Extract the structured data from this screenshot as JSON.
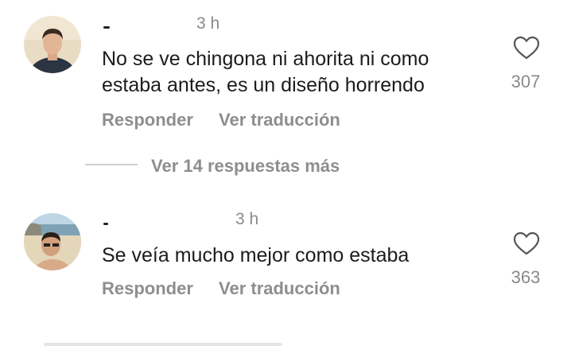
{
  "comments": [
    {
      "time": "3 h",
      "text_line1": "No se ve chingona ni ahorita ni como",
      "text_line2": "estaba antes, es un diseño horrendo",
      "likes": "307",
      "reply_label": "Responder",
      "translate_label": "Ver traducción"
    },
    {
      "time": "3 h",
      "text_line1": "Se veía mucho mejor como estaba",
      "likes": "363",
      "reply_label": "Responder",
      "translate_label": "Ver traducción"
    }
  ],
  "replies": {
    "view_more_label": "Ver 14 respuestas más"
  },
  "icons": {
    "like": "heart-outline-icon"
  },
  "colors": {
    "muted_text": "#8e8e8e",
    "body_text": "#1c1c1c",
    "background": "#ffffff"
  }
}
